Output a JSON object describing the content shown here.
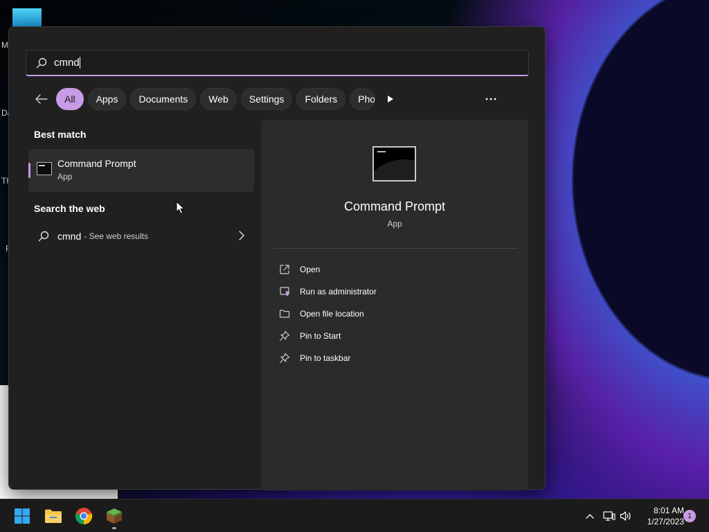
{
  "desktop": {
    "edge_letters": [
      "M",
      "Da",
      "Th",
      "R"
    ]
  },
  "search": {
    "query": "cmnd",
    "placeholder": ""
  },
  "filters": {
    "items": [
      "All",
      "Apps",
      "Documents",
      "Web",
      "Settings",
      "Folders",
      "Pho"
    ],
    "active": "All"
  },
  "results": {
    "best_match_title": "Best match",
    "best_match": {
      "name": "Command Prompt",
      "type": "App"
    },
    "web_title": "Search the web",
    "web_query": "cmnd",
    "web_suffix": "- See web results"
  },
  "preview": {
    "name": "Command Prompt",
    "type": "App",
    "actions": [
      "Open",
      "Run as administrator",
      "Open file location",
      "Pin to Start",
      "Pin to taskbar"
    ]
  },
  "taskbar": {
    "time": "8:01 AM",
    "date": "1/27/2023",
    "notification_count": "1"
  },
  "colors": {
    "accent": "#c89be5",
    "panel_bg": "#202020",
    "preview_bg": "#2b2b2b",
    "taskbar_bg": "#1b1b1b"
  }
}
